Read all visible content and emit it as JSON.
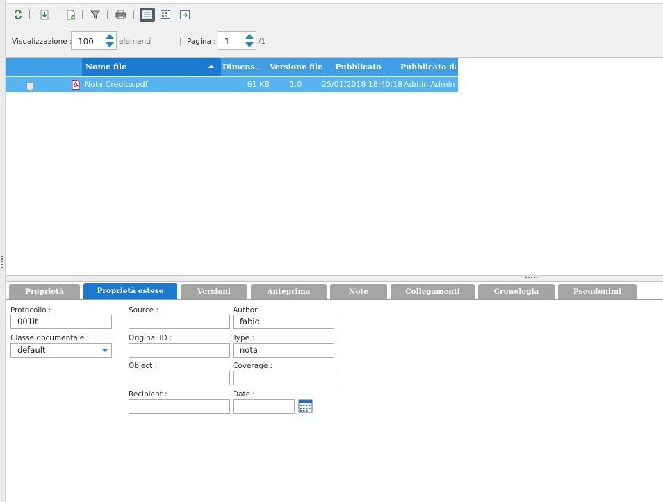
{
  "toolbar": {
    "icons": [
      "refresh-icon",
      "download-icon",
      "new-document-icon",
      "filter-icon",
      "print-icon",
      "list-view-icon",
      "grid-view-icon",
      "export-icon"
    ]
  },
  "pager": {
    "display_label": "Visualizzazione :",
    "page_size": "100",
    "elements_label": "elementi",
    "page_label": "Pagina :",
    "page_value": "1",
    "page_total": "/1"
  },
  "grid": {
    "columns": [
      "Nome file",
      "Dimens...",
      "Versione file",
      "Pubblicato",
      "Pubblicato da"
    ],
    "rows": [
      {
        "name": "Nota Credito.pdf",
        "size": "61 KB",
        "version": "1.0",
        "published": "25/01/2018 18:40:18",
        "published_by": "Admin Admin"
      }
    ]
  },
  "tabs": [
    "Proprietà",
    "Proprietà estese",
    "Versioni",
    "Anteprima",
    "Note",
    "Collegamenti",
    "Cronologia",
    "Pseudonimi"
  ],
  "active_tab": "Proprietà estese",
  "form": {
    "protocollo": {
      "label": "Protocollo :",
      "value": "001it"
    },
    "classe": {
      "label": "Classe documentale :",
      "value": "default"
    },
    "source": {
      "label": "Source :",
      "value": ""
    },
    "original_id": {
      "label": "Original ID :",
      "value": ""
    },
    "object": {
      "label": "Object :",
      "value": ""
    },
    "recipient": {
      "label": "Recipient :",
      "value": ""
    },
    "author": {
      "label": "Author :",
      "value": "fabio"
    },
    "type": {
      "label": "Type :",
      "value": "nota"
    },
    "coverage": {
      "label": "Coverage :",
      "value": ""
    },
    "date": {
      "label": "Date :",
      "value": ""
    }
  },
  "colors": {
    "header_blue": "#3f9ee4",
    "sorted_header_blue": "#1a7ad0",
    "selected_row": "#56b4f2",
    "tab_inactive": "#a4a4a4",
    "accent": "#1c86cf"
  }
}
